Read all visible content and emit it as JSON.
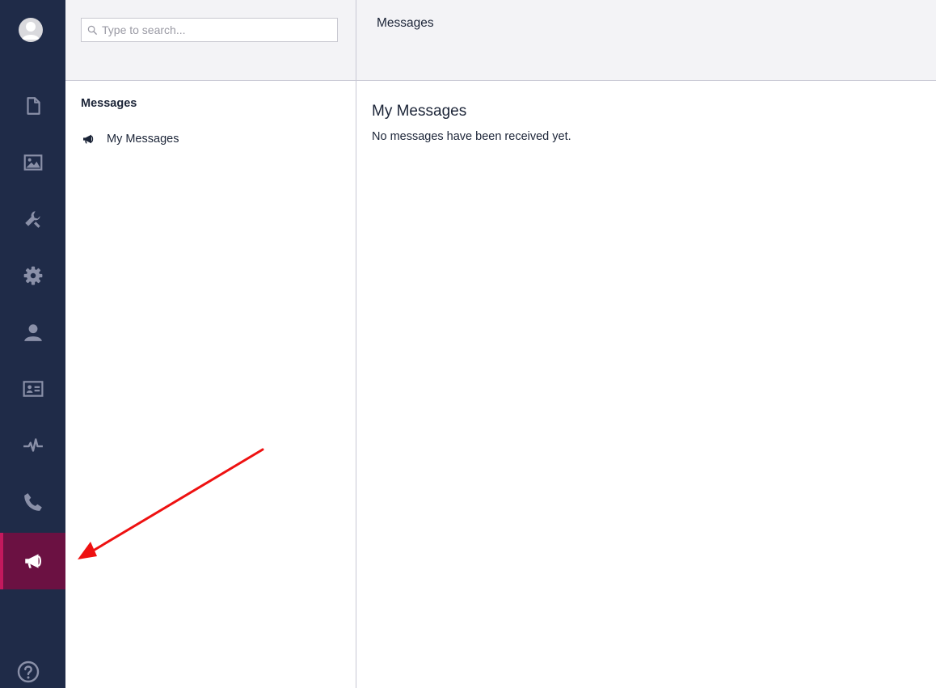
{
  "sidebar": {
    "avatar_icon": "user-avatar-icon",
    "items": [
      {
        "name": "content",
        "icon": "document-icon"
      },
      {
        "name": "media",
        "icon": "picture-icon"
      },
      {
        "name": "settings",
        "icon": "wrench-icon"
      },
      {
        "name": "developer",
        "icon": "gear-icon"
      },
      {
        "name": "users",
        "icon": "user-icon"
      },
      {
        "name": "members",
        "icon": "id-card-icon"
      },
      {
        "name": "analytics",
        "icon": "pulse-icon"
      },
      {
        "name": "contact",
        "icon": "phone-icon"
      },
      {
        "name": "messages",
        "icon": "megaphone-icon",
        "active": true
      }
    ],
    "help_icon": "help-icon",
    "active_color": "#6b1142",
    "background_color": "#1f2b48"
  },
  "search": {
    "placeholder": "Type to search..."
  },
  "tree": {
    "section_title": "Messages",
    "items": [
      {
        "label": "My Messages",
        "icon": "megaphone-icon"
      }
    ]
  },
  "main": {
    "header_title": "Messages",
    "content_title": "My Messages",
    "content_text": "No messages have been received yet."
  },
  "annotation": {
    "type": "arrow",
    "color": "#ee1111",
    "target": "sidebar-item-messages"
  }
}
